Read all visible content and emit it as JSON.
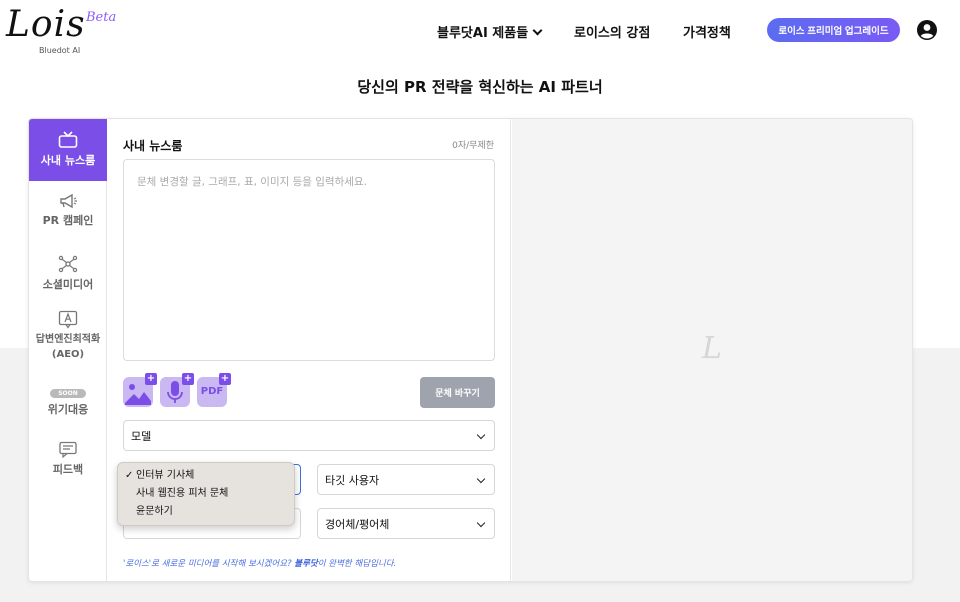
{
  "header": {
    "logo": "Lois",
    "beta": "Beta",
    "logo_sub": "Bluedot AI",
    "nav": [
      "블루닷AI 제품들",
      "로이스의 강점",
      "가격정책"
    ],
    "upgrade": "로이스 프리미엄 업그레이드"
  },
  "tagline": "당신의 PR 전략을 혁신하는 AI 파트너",
  "sidebar": {
    "items": [
      {
        "label": "사내 뉴스룸",
        "icon": "tv-icon"
      },
      {
        "label": "PR 캠페인",
        "icon": "megaphone-icon"
      },
      {
        "label": "소셜미디어",
        "icon": "network-icon"
      },
      {
        "label": "답변엔진최적화",
        "label2": "(AEO)",
        "icon": "ai-text-icon"
      },
      {
        "label": "위기대응",
        "badge": "SOON"
      },
      {
        "label": "피드백",
        "icon": "feedback-icon"
      }
    ]
  },
  "editor": {
    "title": "사내 뉴스룸",
    "count": "0자/무제한",
    "placeholder": "문체 변경할 글, 그래프, 표, 이미지 등을 입력하세요.",
    "attach_pdf": "PDF",
    "change_button": "문체 바꾸기",
    "model_select": "모델",
    "target_select": "타깃 사용자",
    "tone_select": "경어체/평어체",
    "dropdown": {
      "options": [
        "인터뷰 기사체",
        "사내 웹진용 피처 문체",
        "윤문하기"
      ],
      "checked": "✓"
    },
    "footer_a": "'로이스'로 새로운 미디어를 시작해 보시겠어요? ",
    "footer_b": "블루닷",
    "footer_c": "이 완벽한 해답입니다."
  },
  "preview": {
    "watermark": "L"
  },
  "colors": {
    "accent": "#7b4ee8",
    "upgrade_gradient": "#5b6cf0",
    "link": "#4a6fe0"
  }
}
